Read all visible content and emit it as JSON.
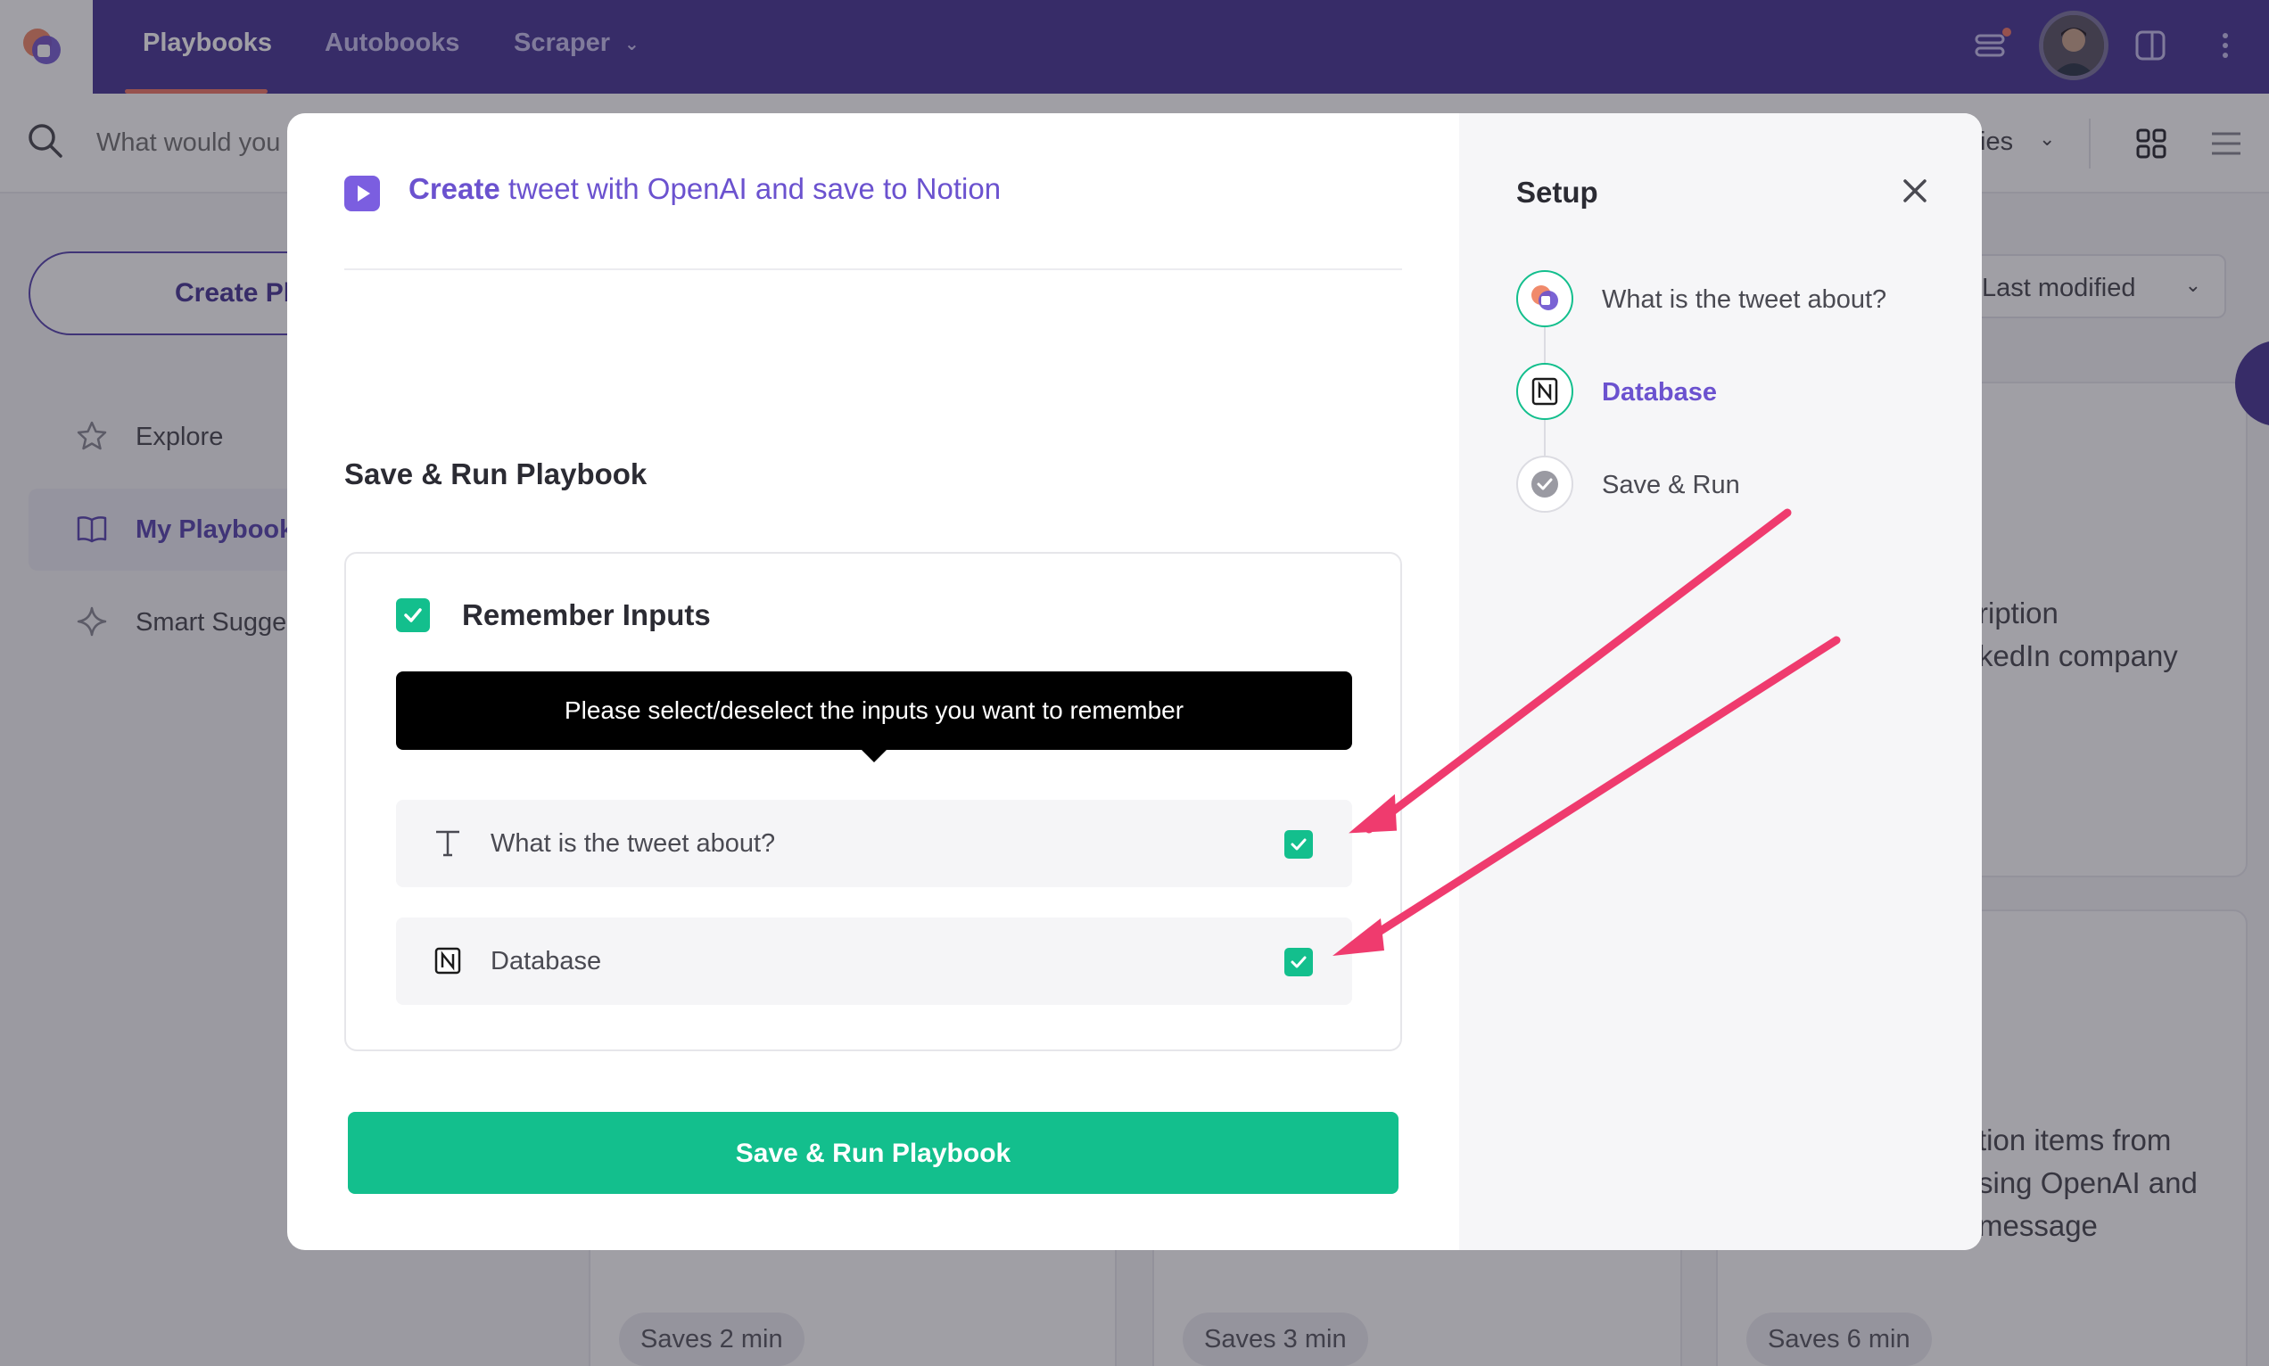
{
  "nav": {
    "items": [
      {
        "label": "Playbooks",
        "active": true
      },
      {
        "label": "Autobooks",
        "active": false
      },
      {
        "label": "Scraper",
        "active": false
      }
    ]
  },
  "search": {
    "placeholder": "What would you",
    "filter_label": "ies"
  },
  "sidebar": {
    "create_label": "Create Pl",
    "items": [
      {
        "label": "Explore",
        "icon": "star-icon",
        "active": false
      },
      {
        "label": "My Playbook",
        "icon": "book-icon",
        "active": true
      },
      {
        "label": "Smart Sugge",
        "icon": "sparkle-icon",
        "active": false
      }
    ]
  },
  "background": {
    "sort_label": "Last modified",
    "card1_lines": [
      "ription",
      "kedIn company"
    ],
    "card2_lines": [
      "tion items from",
      "sing OpenAI and",
      "message"
    ],
    "saves": [
      "Saves 2 min",
      "Saves 3 min",
      "Saves 6 min"
    ]
  },
  "modal": {
    "title_bold": "Create",
    "title_rest": " tweet with OpenAI and save to Notion",
    "section_title": "Save & Run Playbook",
    "remember_label": "Remember Inputs",
    "remember_checked": true,
    "tooltip": "Please select/deselect the inputs you want to remember",
    "inputs": [
      {
        "label": "What is the tweet about?",
        "icon": "text-icon",
        "checked": true
      },
      {
        "label": "Database",
        "icon": "notion-icon",
        "checked": true
      }
    ],
    "run_button": "Save & Run Playbook"
  },
  "setup": {
    "title": "Setup",
    "steps": [
      {
        "label": "What is the tweet about?",
        "icon": "bardeen-logo-icon",
        "state": "done"
      },
      {
        "label": "Database",
        "icon": "notion-icon",
        "state": "active"
      },
      {
        "label": "Save & Run",
        "icon": "check-circle-icon",
        "state": "pending"
      }
    ]
  },
  "colors": {
    "brand": "#4a3996",
    "accent_purple": "#6b52cf",
    "success_green": "#13bf8d",
    "annotation_arrow": "#ef3b6e"
  }
}
